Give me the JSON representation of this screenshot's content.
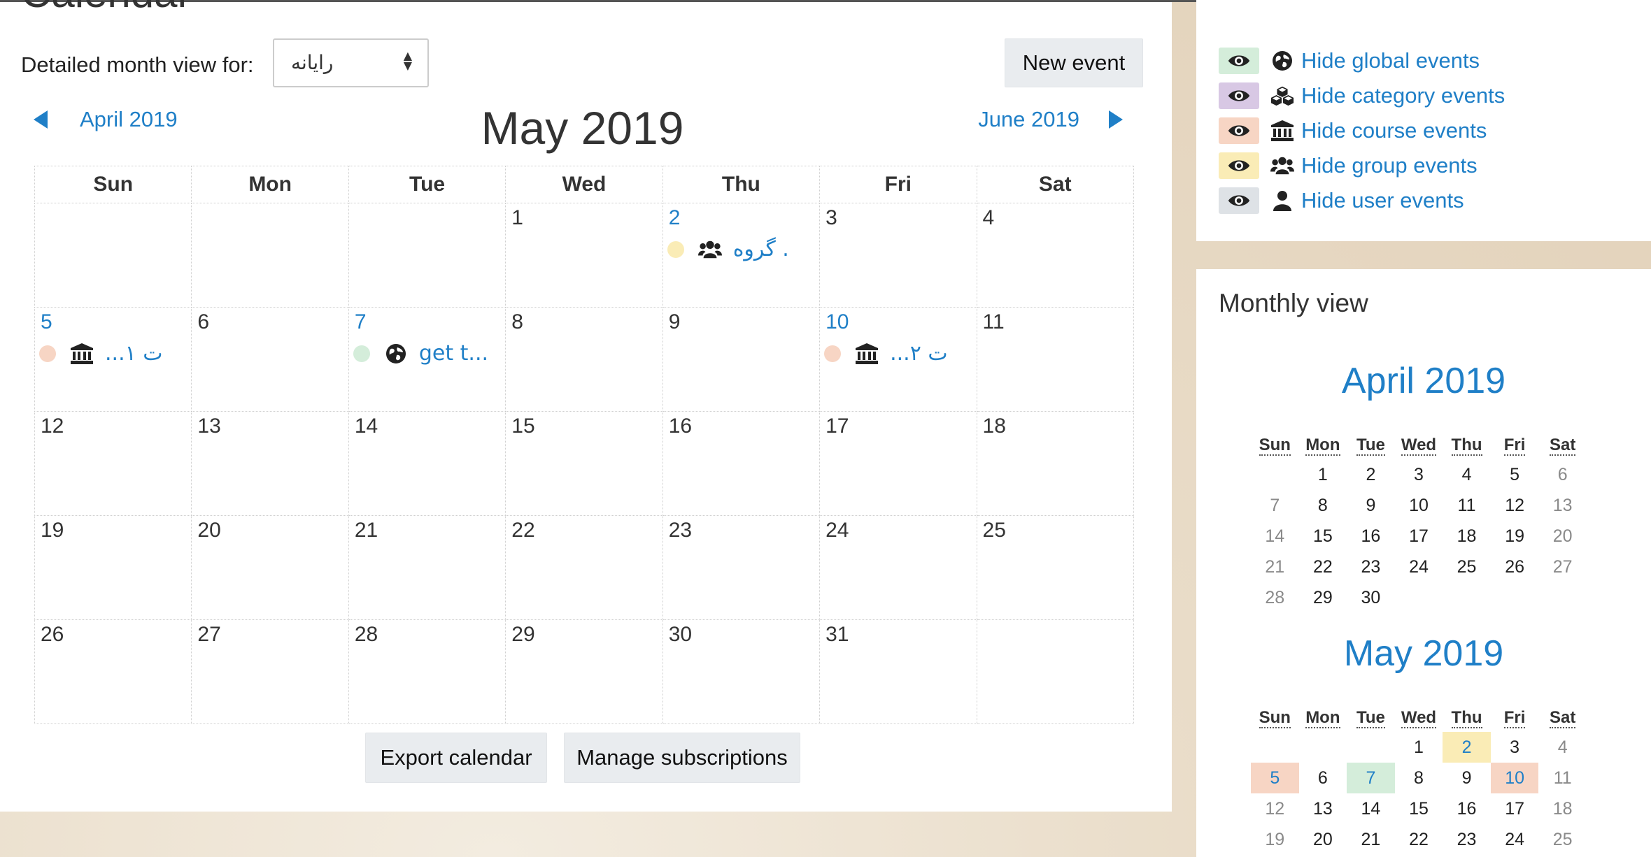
{
  "page": {
    "title": "Calendar",
    "view_label": "Detailed month view for:",
    "view_select_value": "رایانه",
    "new_event_label": "New event",
    "prev_month": "April 2019",
    "next_month": "June 2019",
    "current_month": "May 2019",
    "export_label": "Export calendar",
    "subscriptions_label": "Manage subscriptions"
  },
  "colors": {
    "link": "#1f7fc7",
    "global": "#d4edda",
    "category": "#d8c8e4",
    "course": "#f7d5c4",
    "group": "#faecb6",
    "user": "#dee2e6"
  },
  "calendar": {
    "weekdays": [
      "Sun",
      "Mon",
      "Tue",
      "Wed",
      "Thu",
      "Fri",
      "Sat"
    ],
    "weeks": [
      [
        null,
        null,
        null,
        {
          "day": "1"
        },
        {
          "day": "2",
          "link": true,
          "event": {
            "type": "group",
            "icon": "users-icon",
            "name": "گروه ."
          }
        },
        {
          "day": "3"
        },
        {
          "day": "4"
        }
      ],
      [
        {
          "day": "5",
          "link": true,
          "event": {
            "type": "course",
            "icon": "institution-icon",
            "name": "...ت ۱"
          }
        },
        {
          "day": "6"
        },
        {
          "day": "7",
          "link": true,
          "event": {
            "type": "global",
            "icon": "globe-icon",
            "name": "get t..."
          }
        },
        {
          "day": "8"
        },
        {
          "day": "9"
        },
        {
          "day": "10",
          "link": true,
          "event": {
            "type": "course",
            "icon": "institution-icon",
            "name": "...ت ۲"
          }
        },
        {
          "day": "11"
        }
      ],
      [
        {
          "day": "12"
        },
        {
          "day": "13"
        },
        {
          "day": "14"
        },
        {
          "day": "15"
        },
        {
          "day": "16"
        },
        {
          "day": "17"
        },
        {
          "day": "18"
        }
      ],
      [
        {
          "day": "19"
        },
        {
          "day": "20"
        },
        {
          "day": "21"
        },
        {
          "day": "22"
        },
        {
          "day": "23"
        },
        {
          "day": "24"
        },
        {
          "day": "25"
        }
      ],
      [
        {
          "day": "26"
        },
        {
          "day": "27"
        },
        {
          "day": "28"
        },
        {
          "day": "29"
        },
        {
          "day": "30"
        },
        {
          "day": "31"
        },
        null
      ]
    ]
  },
  "filters": [
    {
      "type": "global",
      "icon": "globe-icon",
      "label": "Hide global events"
    },
    {
      "type": "category",
      "icon": "cubes-icon",
      "label": "Hide category events"
    },
    {
      "type": "course",
      "icon": "institution-icon",
      "label": "Hide course events"
    },
    {
      "type": "group",
      "icon": "users-icon",
      "label": "Hide group events"
    },
    {
      "type": "user",
      "icon": "user-icon",
      "label": "Hide user events"
    }
  ],
  "monthly_view": {
    "title": "Monthly view",
    "weekday_abbr": [
      "Sun",
      "Mon",
      "Tue",
      "Wed",
      "Thu",
      "Fri",
      "Sat"
    ],
    "months": [
      {
        "title": "April 2019",
        "weeks": [
          [
            "",
            "1",
            "2",
            "3",
            "4",
            "5",
            "6"
          ],
          [
            "7",
            "8",
            "9",
            "10",
            "11",
            "12",
            "13"
          ],
          [
            "14",
            "15",
            "16",
            "17",
            "18",
            "19",
            "20"
          ],
          [
            "21",
            "22",
            "23",
            "24",
            "25",
            "26",
            "27"
          ],
          [
            "28",
            "29",
            "30",
            "",
            "",
            "",
            ""
          ]
        ],
        "events": {}
      },
      {
        "title": "May 2019",
        "weeks": [
          [
            "",
            "",
            "",
            "1",
            "2",
            "3",
            "4"
          ],
          [
            "5",
            "6",
            "7",
            "8",
            "9",
            "10",
            "11"
          ],
          [
            "12",
            "13",
            "14",
            "15",
            "16",
            "17",
            "18"
          ],
          [
            "19",
            "20",
            "21",
            "22",
            "23",
            "24",
            "25"
          ]
        ],
        "events": {
          "2": "group",
          "5": "course",
          "7": "global",
          "10": "course"
        }
      }
    ]
  }
}
